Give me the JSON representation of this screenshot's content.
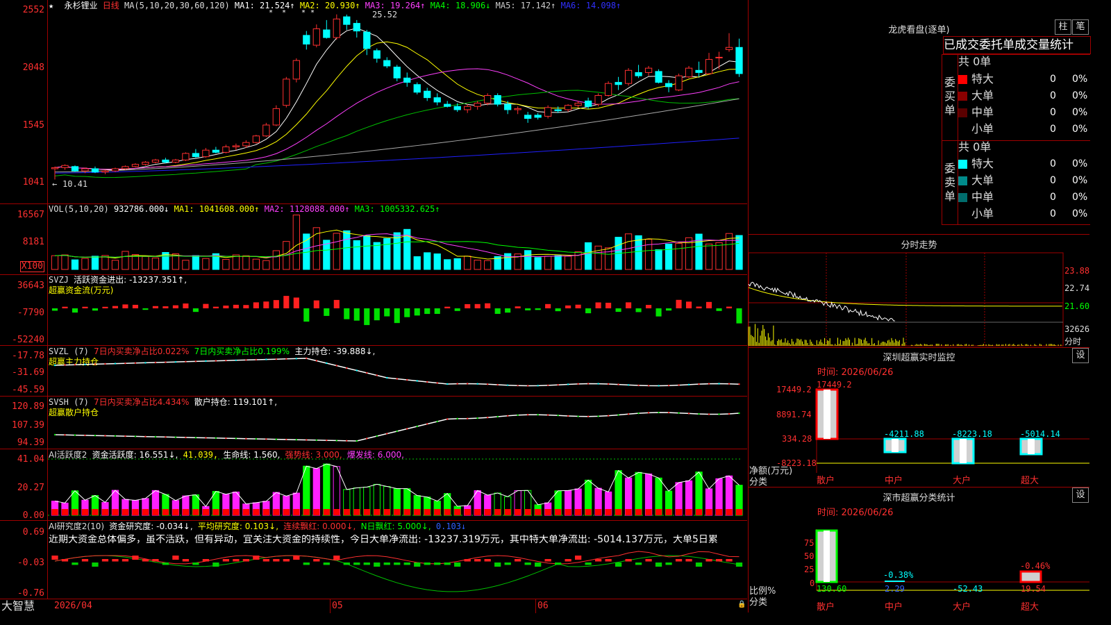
{
  "stock": {
    "name": "永杉锂业",
    "period": "日线"
  },
  "kline": {
    "ma_header": {
      "label": "MA(5,10,20,30,60,120)",
      "ma1": "MA1: 21.524↑",
      "ma2": "MA2: 20.930↑",
      "ma3": "MA3: 19.264↑",
      "ma4": "MA4: 18.906↓",
      "ma5": "MA5: 17.142↑",
      "ma6": "MA6: 14.098↑"
    },
    "y_labels": [
      "2552",
      "2048",
      "1545",
      "1041"
    ],
    "high_marker": "25.52",
    "low_marker": "10.41",
    "candles": [
      [
        11.4,
        11.6,
        10.41,
        11.5
      ],
      [
        11.5,
        11.8,
        11.3,
        11.7
      ],
      [
        11.6,
        11.7,
        11.1,
        11.2
      ],
      [
        11.2,
        11.5,
        11.0,
        11.4
      ],
      [
        11.4,
        11.6,
        11.0,
        11.1
      ],
      [
        11.1,
        11.3,
        10.9,
        11.2
      ],
      [
        11.2,
        11.5,
        11.1,
        11.4
      ],
      [
        11.4,
        11.7,
        11.3,
        11.6
      ],
      [
        11.6,
        11.9,
        11.5,
        11.8
      ],
      [
        11.8,
        12.1,
        11.7,
        12.0
      ],
      [
        12.0,
        12.3,
        11.9,
        12.2
      ],
      [
        12.2,
        12.4,
        11.9,
        12.0
      ],
      [
        12.0,
        12.3,
        11.9,
        12.2
      ],
      [
        12.2,
        12.9,
        12.1,
        12.8
      ],
      [
        12.8,
        13.2,
        12.4,
        12.5
      ],
      [
        12.5,
        13.3,
        12.4,
        13.1
      ],
      [
        13.1,
        13.4,
        12.8,
        12.9
      ],
      [
        12.9,
        13.6,
        12.8,
        13.4
      ],
      [
        13.4,
        13.7,
        13.1,
        13.5
      ],
      [
        13.5,
        14.0,
        13.3,
        13.8
      ],
      [
        13.8,
        14.5,
        13.7,
        14.4
      ],
      [
        14.4,
        15.6,
        14.3,
        15.4
      ],
      [
        15.4,
        17.2,
        15.3,
        16.9
      ],
      [
        17.2,
        19.8,
        17.0,
        19.6
      ],
      [
        19.6,
        21.5,
        19.3,
        21.3
      ],
      [
        23.6,
        24.0,
        22.3,
        22.8
      ],
      [
        22.7,
        24.6,
        22.5,
        24.2
      ],
      [
        24.1,
        25.0,
        23.3,
        23.4
      ],
      [
        23.4,
        25.52,
        23.2,
        25.1
      ],
      [
        25.3,
        25.5,
        24.1,
        24.6
      ],
      [
        24.7,
        25.0,
        23.4,
        24.0
      ],
      [
        23.9,
        24.1,
        21.8,
        22.4
      ],
      [
        22.2,
        22.4,
        21.1,
        21.5
      ],
      [
        21.3,
        21.6,
        20.6,
        20.8
      ],
      [
        20.7,
        20.9,
        19.4,
        19.7
      ],
      [
        19.7,
        20.2,
        18.9,
        19.3
      ],
      [
        19.1,
        19.3,
        18.2,
        18.4
      ],
      [
        18.5,
        18.8,
        17.6,
        17.9
      ],
      [
        17.9,
        18.3,
        17.2,
        17.5
      ],
      [
        17.3,
        17.6,
        17.0,
        17.1
      ],
      [
        17.1,
        17.4,
        16.6,
        16.8
      ],
      [
        16.8,
        17.3,
        16.5,
        17.1
      ],
      [
        17.1,
        17.6,
        16.8,
        17.4
      ],
      [
        17.4,
        18.3,
        17.2,
        18.1
      ],
      [
        18.1,
        18.3,
        17.1,
        17.3
      ],
      [
        17.3,
        17.6,
        16.4,
        16.8
      ],
      [
        16.8,
        17.1,
        16.4,
        16.9
      ],
      [
        16.3,
        16.6,
        15.6,
        16.0
      ],
      [
        16.3,
        16.5,
        15.9,
        16.1
      ],
      [
        16.2,
        17.2,
        16.0,
        17.0
      ],
      [
        16.8,
        17.1,
        16.5,
        16.7
      ],
      [
        16.8,
        17.3,
        16.6,
        17.2
      ],
      [
        17.2,
        17.6,
        17.0,
        17.4
      ],
      [
        17.6,
        17.9,
        16.9,
        17.1
      ],
      [
        17.3,
        18.3,
        17.1,
        18.1
      ],
      [
        18.1,
        19.4,
        18.0,
        19.2
      ],
      [
        19.3,
        19.8,
        18.6,
        19.1
      ],
      [
        19.2,
        20.6,
        19.0,
        20.4
      ],
      [
        20.2,
        20.9,
        19.7,
        19.9
      ],
      [
        20.2,
        20.8,
        19.9,
        20.6
      ],
      [
        20.3,
        20.5,
        19.2,
        19.3
      ],
      [
        19.2,
        19.5,
        18.4,
        18.9
      ],
      [
        18.6,
        20.1,
        18.5,
        19.9
      ],
      [
        19.8,
        20.8,
        19.7,
        20.6
      ],
      [
        20.4,
        21.2,
        19.8,
        20.2
      ],
      [
        20.1,
        22.0,
        20.0,
        21.4
      ],
      [
        21.6,
        22.1,
        20.5,
        21.6
      ],
      [
        22.3,
        23.8,
        22.1,
        22.5
      ],
      [
        22.5,
        23.3,
        19.8,
        20.1
      ]
    ]
  },
  "volume": {
    "header": {
      "label": "VOL(5,10,20)",
      "val": "932786.000↓",
      "ma1": "MA1: 1041608.000↑",
      "ma2": "MA2: 1128088.000↑",
      "ma3": "MA3: 1005332.625↑"
    },
    "y_labels": [
      "16567",
      "8181",
      "X100"
    ]
  },
  "svzj": {
    "header": {
      "name": "SVZJ",
      "text": "活跃资金进出: -13237.351↑,",
      "sub": "超赢资金流(万元)"
    },
    "y_labels": [
      "36643",
      "-7790",
      "-52240"
    ]
  },
  "svzl": {
    "header": {
      "name": "SVZL (7)",
      "red": "7日内买卖净占比0.022%",
      "green": "7日内买卖净占比0.199%",
      "white": "主力持仓: -39.888↓,",
      "sub": "超赢主力持仓"
    },
    "y_labels": [
      "-17.78",
      "-31.69",
      "-45.59"
    ]
  },
  "svsh": {
    "header": {
      "name": "SVSH (7)",
      "red": "7日内买卖净占比4.434%",
      "white": "散户持仓: 119.101↑,",
      "sub": "超赢散户持仓"
    },
    "y_labels": [
      "120.89",
      "107.39",
      "94.39"
    ]
  },
  "ai1": {
    "header": {
      "name": "AI活跃度2",
      "v1": "资金活跃度: 16.551↓,",
      "v2": "41.039,",
      "v3": "生命线: 1.560,",
      "v4": "强势线: 3.000,",
      "v5": "爆发线: 6.000,"
    },
    "y_labels": [
      "41.04",
      "20.27",
      "0.00"
    ]
  },
  "ai2": {
    "header": {
      "name": "AI研究度2(10)",
      "v1": "资金研究度: -0.034↓,",
      "v2": "平均研究度: 0.103↓,",
      "v3": "连续飘红: 0.000↓,",
      "v4": "N日飘红: 5.000↓,",
      "v5": "0.103↓"
    },
    "comment": "近期大资金总体偏多，虽不活跃，但有异动，宜关注大资金的持续性，今日大单净流出: -13237.319万元，其中特大单净流出: -5014.137万元，大单5日累",
    "y_labels": [
      "0.69",
      "-0.03",
      "-0.76"
    ]
  },
  "bottom": {
    "brand": "大智慧",
    "date_start": "2026/04",
    "month5": "05",
    "month6": "06"
  },
  "right": {
    "lhb_title": "龙虎看盘(逐单)",
    "btn_zhu": "柱",
    "btn_zhe": "笔",
    "tabs": "已成交委托单成交量统计",
    "buy_label": "委买单",
    "sell_label": "委卖单",
    "buy_total": "共 0单",
    "sell_total": "共 0单",
    "buy_rows": [
      {
        "label": "特大",
        "n": "0",
        "p": "0%",
        "color": "#ff0000"
      },
      {
        "label": "大单",
        "n": "0",
        "p": "0%",
        "color": "#8b0000"
      },
      {
        "label": "中单",
        "n": "0",
        "p": "0%",
        "color": "#5a0000"
      },
      {
        "label": "小单",
        "n": "0",
        "p": "0%",
        "color": ""
      }
    ],
    "sell_rows": [
      {
        "label": "特大",
        "n": "0",
        "p": "0%",
        "color": "#00ffff"
      },
      {
        "label": "大单",
        "n": "0",
        "p": "0%",
        "color": "#008b8b"
      },
      {
        "label": "中单",
        "n": "0",
        "p": "0%",
        "color": "#006d6d"
      },
      {
        "label": "小单",
        "n": "0",
        "p": "0%",
        "color": ""
      }
    ],
    "intraday_title": "分时走势",
    "intraday_y": [
      "23.88",
      "22.74",
      "21.60",
      "32626",
      "分时"
    ],
    "sz_title": "深圳超赢实时监控",
    "sz_set": "设",
    "sz_time": "时间: 2026/06/26",
    "sz_y": [
      "17449.2",
      "8891.74",
      "334.28",
      "-8223.18"
    ],
    "sz_unit1": "净额(万元)",
    "sz_unit2": "分类",
    "sz_vals": [
      "17449.2",
      "-4211.88",
      "-8223.18",
      "-5014.14"
    ],
    "sz_cats": [
      "散户",
      "中户",
      "大户",
      "超大"
    ],
    "fl_title": "深市超赢分类统计",
    "fl_set": "设",
    "fl_time": "时间: 2026/06/26",
    "fl_y": [
      "75",
      "50",
      "25",
      "0"
    ],
    "fl_unit1": "比例%",
    "fl_unit2": "分类",
    "fl_top": [
      "-0.38%",
      "-0.46%"
    ],
    "fl_vals": [
      "130.60",
      "2.29",
      "-52.43",
      "19.54"
    ],
    "fl_cats": [
      "散户",
      "中户",
      "大户",
      "超大"
    ]
  }
}
